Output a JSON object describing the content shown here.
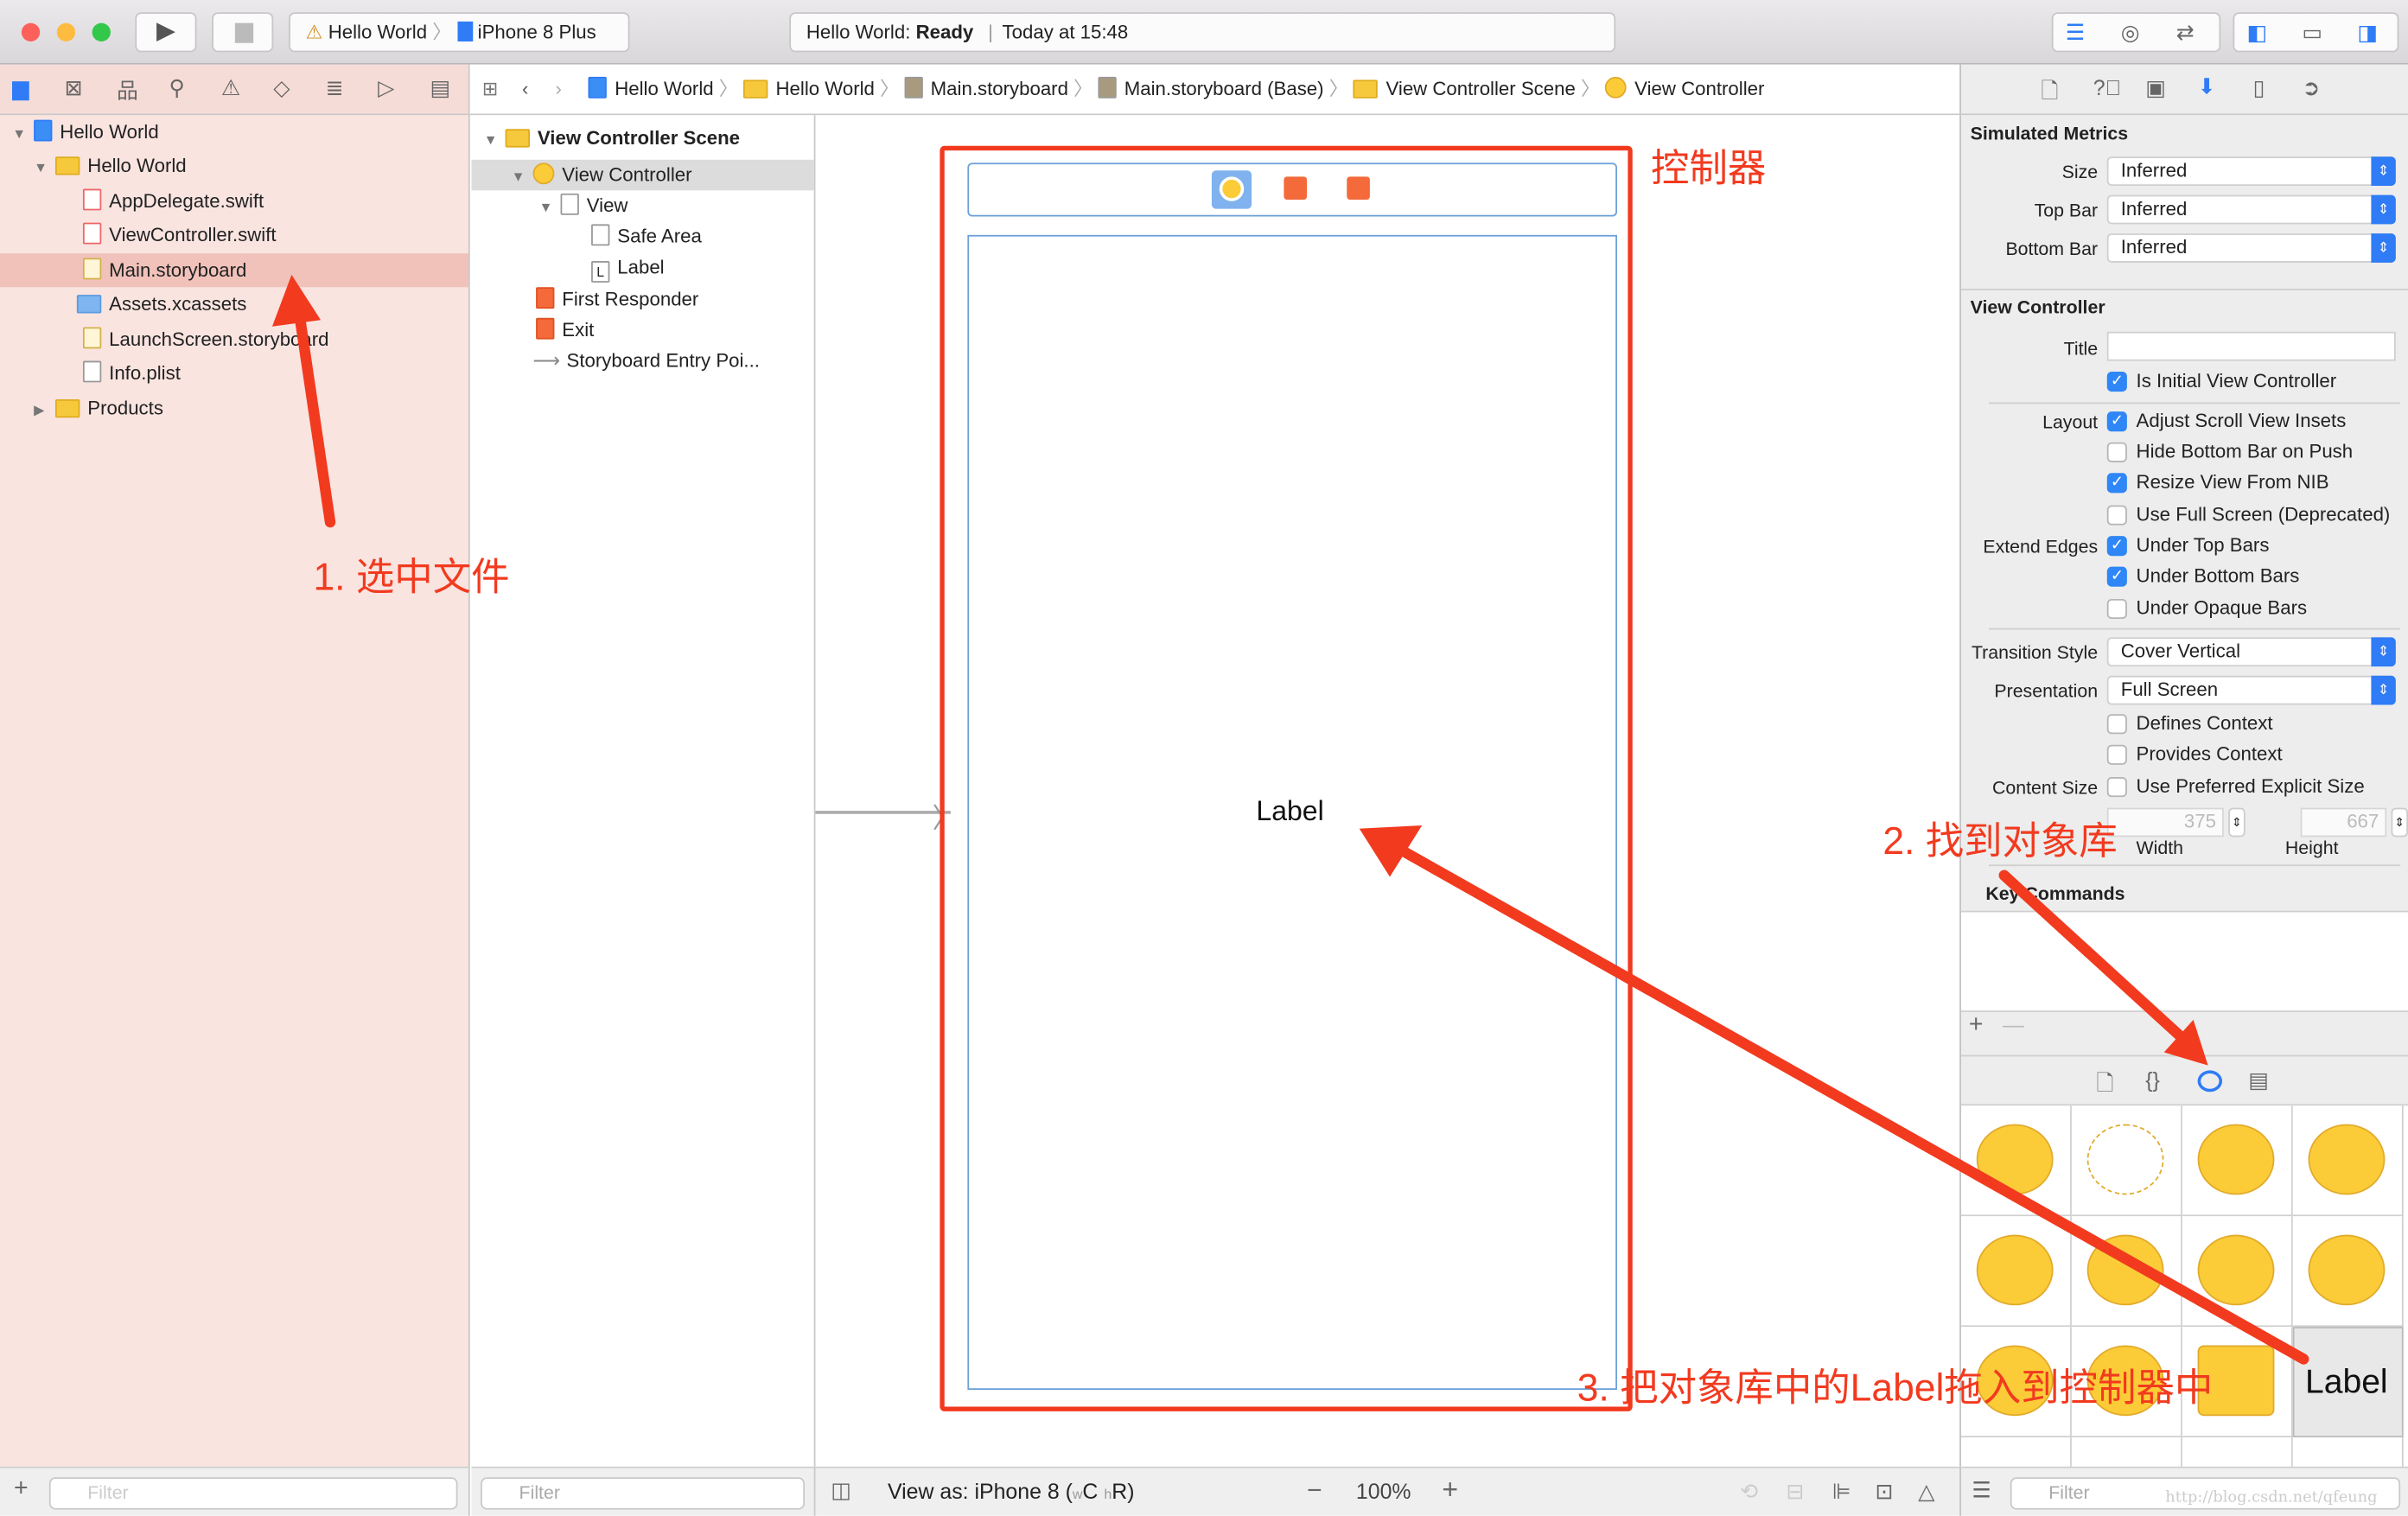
{
  "titlebar": {
    "scheme": "Hello World",
    "device": "iPhone 8 Plus",
    "status_project": "Hello World:",
    "status_state": "Ready",
    "status_time": "Today at 15:48"
  },
  "jumpbar": [
    "Hello World",
    "Hello World",
    "Main.storyboard",
    "Main.storyboard (Base)",
    "View Controller Scene",
    "View Controller"
  ],
  "navigator": {
    "items": [
      {
        "label": "Hello World",
        "icon": "project-icon"
      },
      {
        "label": "Hello World",
        "icon": "folder-icon"
      },
      {
        "label": "AppDelegate.swift",
        "icon": "swift-file-icon"
      },
      {
        "label": "ViewController.swift",
        "icon": "swift-file-icon"
      },
      {
        "label": "Main.storyboard",
        "icon": "storyboard-icon",
        "selected": true
      },
      {
        "label": "Assets.xcassets",
        "icon": "assets-folder-icon"
      },
      {
        "label": "LaunchScreen.storyboard",
        "icon": "storyboard-icon"
      },
      {
        "label": "Info.plist",
        "icon": "plist-icon"
      },
      {
        "label": "Products",
        "icon": "folder-icon"
      }
    ],
    "filter_placeholder": "Filter"
  },
  "outline": {
    "items": [
      "View Controller Scene",
      "View Controller",
      "View",
      "Safe Area",
      "Label",
      "First Responder",
      "Exit",
      "Storyboard Entry Poi..."
    ],
    "filter_placeholder": "Filter"
  },
  "canvas": {
    "label_text": "Label",
    "view_as": "View as: iPhone 8 (",
    "size_w": "w",
    "size_c": "C",
    "size_h": "h",
    "size_r": "R)",
    "zoom": "100%"
  },
  "inspector": {
    "simulated_metrics": "Simulated Metrics",
    "size_label": "Size",
    "size_value": "Inferred",
    "topbar_label": "Top Bar",
    "topbar_value": "Inferred",
    "bottombar_label": "Bottom Bar",
    "bottombar_value": "Inferred",
    "view_controller": "View Controller",
    "title_label": "Title",
    "title_value": "",
    "is_initial": {
      "label": "Is Initial View Controller",
      "checked": true
    },
    "layout_label": "Layout",
    "layout": [
      {
        "label": "Adjust Scroll View Insets",
        "checked": true
      },
      {
        "label": "Hide Bottom Bar on Push",
        "checked": false
      },
      {
        "label": "Resize View From NIB",
        "checked": true
      },
      {
        "label": "Use Full Screen (Deprecated)",
        "checked": false
      }
    ],
    "extend_label": "Extend Edges",
    "extend": [
      {
        "label": "Under Top Bars",
        "checked": true
      },
      {
        "label": "Under Bottom Bars",
        "checked": true
      },
      {
        "label": "Under Opaque Bars",
        "checked": false
      }
    ],
    "transition_label": "Transition Style",
    "transition_value": "Cover Vertical",
    "presentation_label": "Presentation",
    "presentation_value": "Full Screen",
    "defines_context": {
      "label": "Defines Context",
      "checked": false
    },
    "provides_context": {
      "label": "Provides Context",
      "checked": false
    },
    "content_size_label": "Content Size",
    "preferred_size": {
      "label": "Use Preferred Explicit Size",
      "checked": false
    },
    "width_value": "375",
    "width_label": "Width",
    "height_value": "667",
    "height_label": "Height",
    "key_commands": "Key Commands"
  },
  "library": {
    "label_item": "Label",
    "filter_placeholder": "Filter",
    "watermark": "http://blog.csdn.net/qfeung"
  },
  "annotations": {
    "controller": "控制器",
    "step1": "1. 选中文件",
    "step2": "2. 找到对象库",
    "step3": "3. 把对象库中的Label拖入到控制器中",
    "color": "#f23a1f"
  },
  "colors": {
    "accent": "#2f7cf6",
    "selection_nav": "#f0c2ba",
    "annotation": "#f23a1f",
    "library_coin": "#fbcc37"
  }
}
